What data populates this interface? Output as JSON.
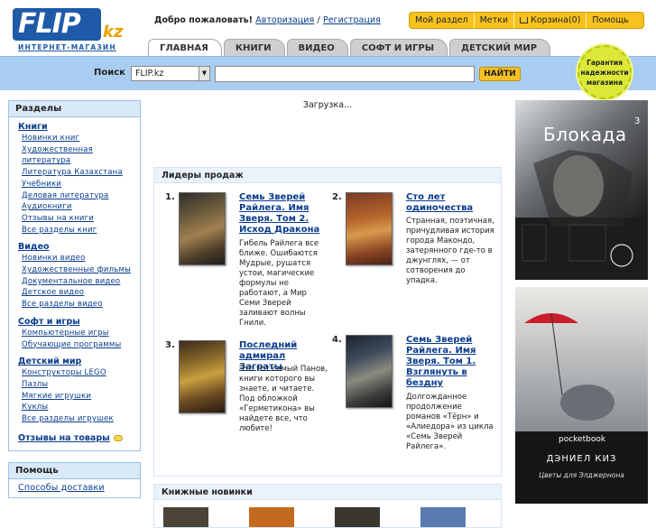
{
  "logo": {
    "text": "FLIP",
    "suffix": "kz",
    "subtitle": "ИНТЕРНЕТ-МАГАЗИН"
  },
  "header": {
    "welcome": "Добро пожаловать!",
    "login": "Авторизация",
    "separator": "/",
    "register": "Регистрация"
  },
  "topmenu": [
    "Мой раздел",
    "Метки",
    "Корзина(0)",
    "Помощь"
  ],
  "tabs": [
    "ГЛАВНАЯ",
    "КНИГИ",
    "ВИДЕО",
    "СОФТ И ИГРЫ",
    "ДЕТСКИЙ МИР"
  ],
  "search": {
    "label": "Поиск",
    "scope": "FLIP.kz",
    "query": "",
    "button": "НАЙТИ"
  },
  "guarantee_badge": "Гарантия надежности магазина",
  "sections": {
    "title": "Разделы",
    "books": {
      "label": "Книги",
      "items": [
        "Новинки книг",
        "Художественная литература",
        "Литература Казахстана",
        "Учебники",
        "Деловая литература",
        "Аудиокниги",
        "Отзывы на книги",
        "Все разделы книг"
      ]
    },
    "video": {
      "label": "Видео",
      "items": [
        "Новинки видео",
        "Художественные фильмы",
        "Документальное видео",
        "Детское видео",
        "Все разделы видео"
      ]
    },
    "soft": {
      "label": "Софт и игры",
      "items": [
        "Компьютерные игры",
        "Обучающие программы"
      ]
    },
    "kids": {
      "label": "Детский мир",
      "items": [
        "Конструкторы LEGO",
        "Пазлы",
        "Мягкие игрушки",
        "Куклы",
        "Все разделы игрушек"
      ]
    },
    "reviews": "Отзывы на товары"
  },
  "help": {
    "title": "Помощь",
    "items": [
      "Способы доставки"
    ]
  },
  "center": {
    "loading": "Загрузка...",
    "bestsellers_title": "Лидеры продаж",
    "bestsellers": [
      {
        "num": "1.",
        "title": "Семь Зверей Райлега. Имя Зверя. Том 2. Исход Дракона",
        "desc": "Гибель Райлега все ближе. Ошибаются Мудрые, рушатся устои, магические формулы не работают, а Мир Семи Зверей заливают волны Гнили."
      },
      {
        "num": "2.",
        "title": "Сто лет одиночества",
        "desc": "Странная, поэтичная, причудливая история города Макондо, затерянного где-то в джунглях, — от сотворения до упадка."
      },
      {
        "num": "3.",
        "title": "Последний адмирал Заграты",
        "desc": "Это тот самый Панов, книги которого вы знаете, и читаете. Под обложкой «Герметикона» вы найдете все, что любите!"
      },
      {
        "num": "4.",
        "title": "Семь Зверей Райлега. Имя Зверя. Том 1. Взглянуть в бездну",
        "desc": "Долгожданное продолжение романов «Тёрн» и «Алиедора» из цикла «Семь Зверей Райлега»."
      }
    ],
    "newbooks_title": "Книжные новинки"
  },
  "ads": {
    "banner1": {
      "title": "Блокада",
      "superscript": "3"
    },
    "banner2": {
      "brand": "pocketbook",
      "author": "ДЭНИЕЛ КИЗ",
      "book": "Цветы для Элджернона"
    }
  },
  "colors": {
    "brand_blue": "#1e5aa8",
    "accent_yellow": "#f7c21d",
    "search_bar": "#a9cdf0",
    "link": "#0a3c8c"
  }
}
